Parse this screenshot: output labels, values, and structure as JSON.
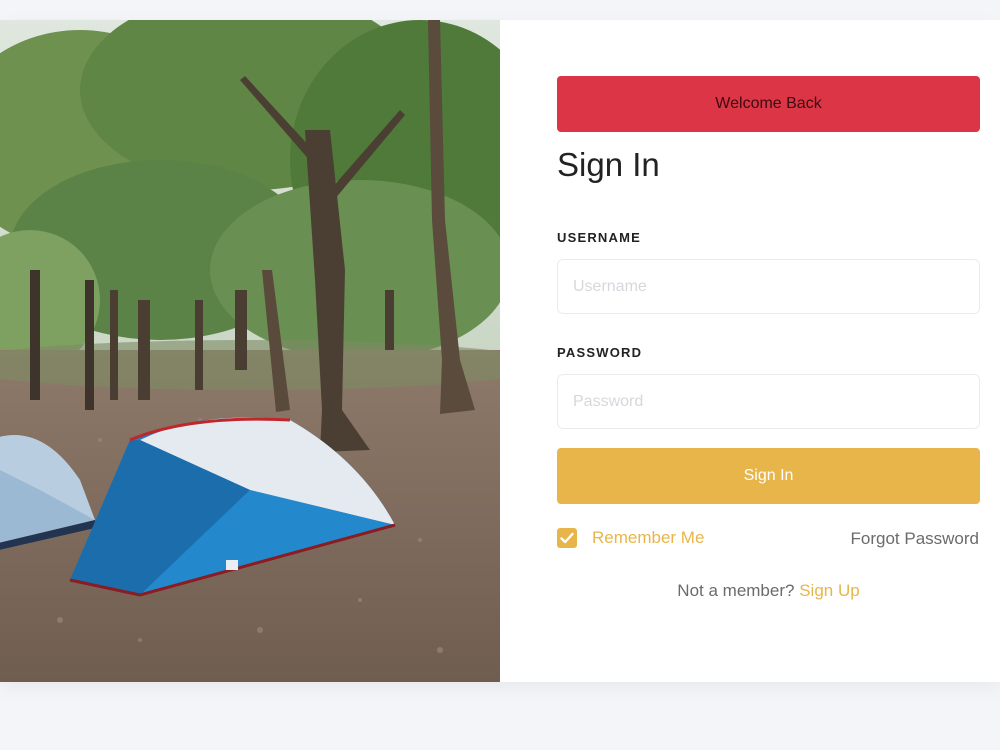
{
  "colors": {
    "banner": "#dc3545",
    "accent": "#e8b54a",
    "background": "#f3f5f9",
    "muted_text": "#6b6b6b"
  },
  "banner": {
    "text": "Welcome Back"
  },
  "form": {
    "title": "Sign In",
    "username": {
      "label": "USERNAME",
      "placeholder": "Username",
      "value": ""
    },
    "password": {
      "label": "PASSWORD",
      "placeholder": "Password",
      "value": ""
    },
    "submit_label": "Sign In",
    "remember_me": {
      "label": "Remember Me",
      "checked": true
    },
    "forgot_password": "Forgot Password",
    "signup_prompt": "Not a member?",
    "signup_link": "Sign Up"
  },
  "icons": {
    "checkbox": "checkmark-icon"
  }
}
